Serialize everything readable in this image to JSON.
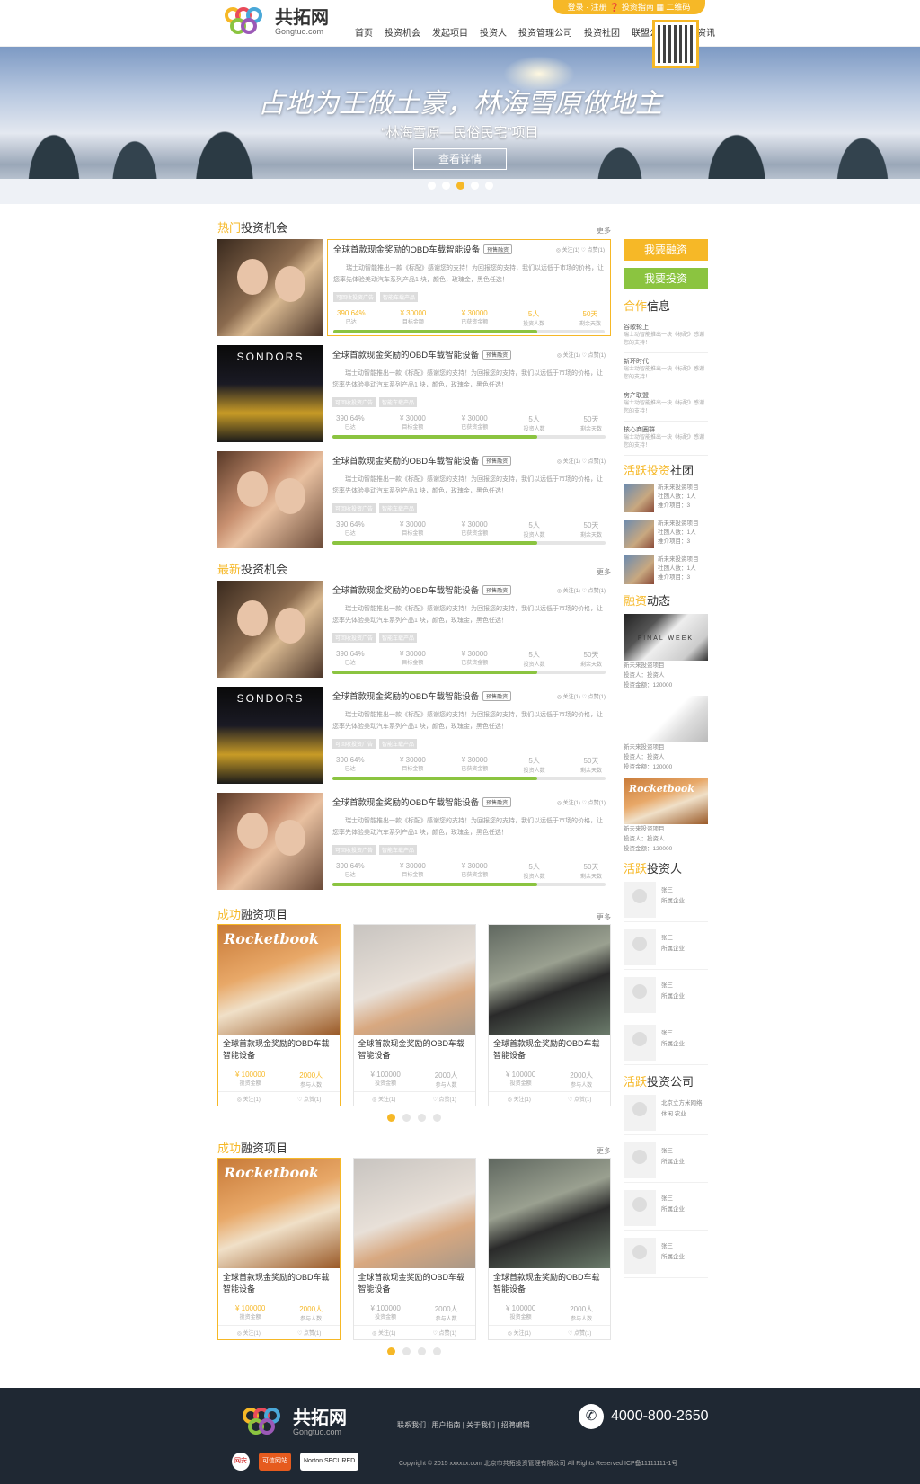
{
  "header": {
    "logo_text": "共拓网",
    "logo_sub": "Gongtuo.com",
    "topbar": "登录 · 注册   ❓ 投资指南   ▦ 二维码",
    "nav": [
      "首页",
      "投资机会",
      "发起项目",
      "投资人",
      "投资管理公司",
      "投资社团",
      "联盟公司",
      "推广资讯"
    ]
  },
  "banner": {
    "title": "占地为王做土豪，林海雪原做地主",
    "subtitle": "“林海雪原—民俗民宅”项目",
    "button": "查看详情"
  },
  "hot": {
    "title_em": "热门",
    "title": "投资机会",
    "more": "更多"
  },
  "latest": {
    "title_em": "最新",
    "title": "投资机会",
    "more": "更多"
  },
  "success1": {
    "title_em": "成功",
    "title": "融资项目",
    "more": "更多"
  },
  "success2": {
    "title_em": "成功",
    "title": "融资项目",
    "more": "更多"
  },
  "project": {
    "title": "全球首款现金奖励的OBD车载智能设备",
    "tag": "预售融资",
    "follow": "◎ 关注(1)",
    "like": "♡ 点赞(1)",
    "desc": "瑞士动智能推出一款《标配》感谢您的支持！为回报您的支持，我们以远低于市场的价格，让您率先体验美动汽车系列产品1 块，颜色，玫瑰金，黑色任选！",
    "tags": [
      "可回收投资广告",
      "智能车载产品"
    ],
    "s1": "390.64%",
    "s1l": "已达",
    "s2": "¥ 30000",
    "s2l": "目标金额",
    "s3": "¥ 30000",
    "s3l": "已获资金额",
    "s4": "5人",
    "s4l": "投资人数",
    "s5": "50天",
    "s5l": "剩余天数",
    "progress": 0.75
  },
  "gproject": {
    "title": "全球首款现金奖励的OBD车载智能设备",
    "amount": "¥ 100000",
    "amount_l": "投资金额",
    "people": "2000人",
    "people_l": "参与人数",
    "follow": "◎ 关注(1)",
    "like": "♡ 点赞(1)",
    "rocketbook": "Rocketbook"
  },
  "side": {
    "btn_finance": "我要融资",
    "btn_invest": "我要投资",
    "coop_em": "合作",
    "coop": "信息",
    "coop_items": [
      {
        "name": "谷歌轮上",
        "desc": "瑞士动智能推出一块《标配》感谢您的支持！"
      },
      {
        "name": "新环时代",
        "desc": "瑞士动智能推出一块《标配》感谢您的支持！"
      },
      {
        "name": "房产联盟",
        "desc": "瑞士动智能推出一块《标配》感谢您的支持！"
      },
      {
        "name": "核心商圈群",
        "desc": "瑞士动智能推出一块《标配》感谢您的支持！"
      }
    ],
    "club_em": "活跃投资",
    "club": "社团",
    "club_item": {
      "name": "新未来投资项目",
      "members": "社团人数：1人",
      "projects": "推介项目：3"
    },
    "fin_em": "融资",
    "fin": "动态",
    "fin_item": {
      "name": "新未来投资项目",
      "investor": "投资人：投资人",
      "amount": "投资金额：120000"
    },
    "final_week": "FINAL WEEK",
    "inv_em": "活跃",
    "inv": "投资人",
    "person": {
      "name": "张三",
      "company": "所属企业"
    },
    "comp_em": "活跃",
    "comp": "投资公司",
    "company_first": {
      "name": "北京立方米网络",
      "type": "休闲  农业"
    }
  },
  "footer": {
    "links": "联系我们  |  用户指南  |  关于我们  |  招聘编辑",
    "phone": "4000-800-2650",
    "phone_icon": "phone-icon",
    "copyright": "Copyright © 2015 xxxxxx.com 北京市共拓投资管理有限公司 All Rights Reserved ICP备11111111-1号",
    "badges": [
      "网安",
      "可信网站",
      "Norton SECURED"
    ]
  },
  "colors": {
    "accent": "#f6b827",
    "green": "#8bc440",
    "footer_bg": "#1f2833"
  }
}
